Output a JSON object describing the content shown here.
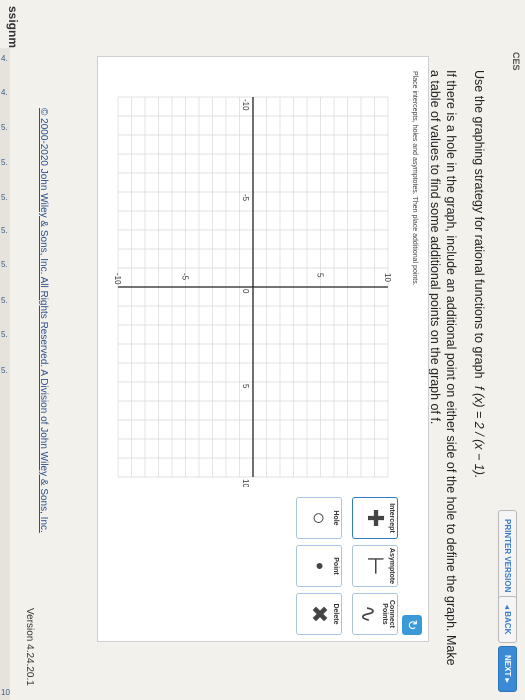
{
  "header": {
    "assignment": "ssignment",
    "section_tab": "CES"
  },
  "side": {
    "items": [
      "4.",
      "4.",
      "5.",
      "5.",
      "5.",
      "5.",
      "5.",
      "5.",
      "5.",
      "5.",
      "10"
    ]
  },
  "toolbar": {
    "printer_version": "PRINTER VERSION",
    "back": "◂ BACK",
    "next": "NEXT ▸"
  },
  "question": {
    "prompt": "Use the graphing strategy for rational functions to graph",
    "function": "f (x) = 2 / (x − 1).",
    "hole_note": "If there is a hole in the graph, include an additional point on either side of the hole to define the graph. Make a table of values to find some additional points on the graph of f."
  },
  "graph": {
    "instructions": "Place intercepts, holes and asymptotes. Then place additional points.",
    "x_ticks": [
      "-10",
      "-5",
      "0",
      "5",
      "10"
    ],
    "y_ticks": [
      "10",
      "5",
      "-5",
      "-10"
    ]
  },
  "tools": {
    "intercept": "Intercept",
    "hole": "Hole",
    "asymptote": "Asymptote",
    "point": "Point",
    "delete": "Delete",
    "connect": "Connect Points"
  },
  "footer": {
    "copyright": "© 2000-2020 John Wiley & Sons, Inc. All Rights Reserved. A Division of John Wiley & Sons, Inc.",
    "version": "Version 4.24.20.1"
  },
  "colors": {
    "accent": "#3a8ad6",
    "grid": "#d8d8d8",
    "axis": "#222222"
  }
}
